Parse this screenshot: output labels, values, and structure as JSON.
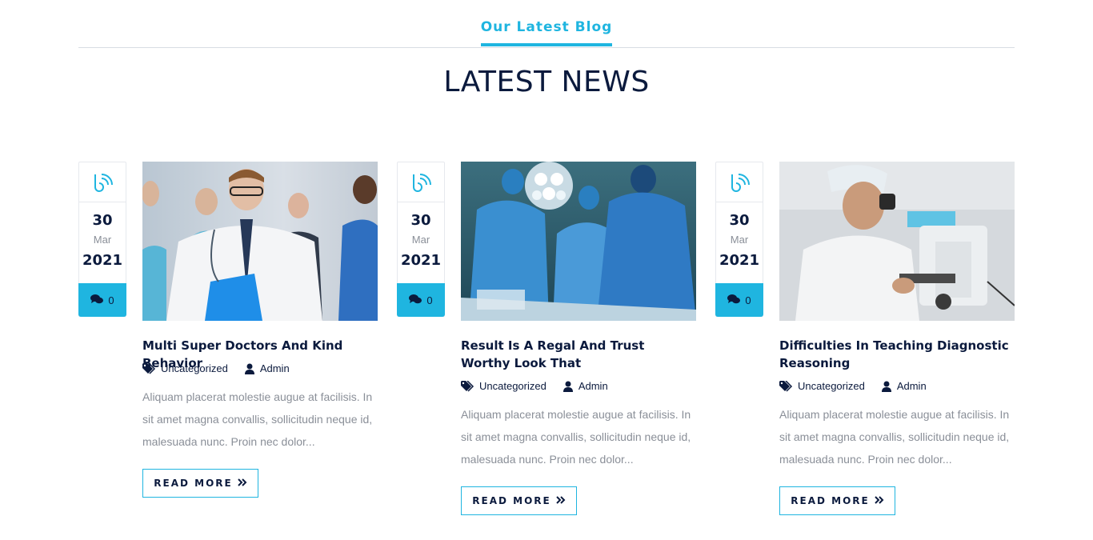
{
  "section": {
    "tag": "Our Latest Blog",
    "title": "LATEST NEWS"
  },
  "accent_color": "#1fb5e0",
  "heading_color": "#0b1a3d",
  "posts": [
    {
      "day": "30",
      "month": "Mar",
      "year": "2021",
      "comments": "0",
      "image": "doctors-team-photo",
      "title": "Multi Super Doctors And Kind Behavior",
      "category": "Uncategorized",
      "author": "Admin",
      "excerpt": "Aliquam placerat molestie augue at facilisis. In sit amet magna convallis, sollicitudin neque id, malesuada nunc. Proin nec dolor...",
      "read_more": "READ MORE"
    },
    {
      "day": "30",
      "month": "Mar",
      "year": "2021",
      "comments": "0",
      "image": "surgery-room-photo",
      "title": "Result Is A Regal And Trust Worthy Look That",
      "category": "Uncategorized",
      "author": "Admin",
      "excerpt": "Aliquam placerat molestie augue at facilisis. In sit amet magna convallis, sollicitudin neque id, malesuada nunc. Proin nec dolor...",
      "read_more": "READ MORE"
    },
    {
      "day": "30",
      "month": "Mar",
      "year": "2021",
      "comments": "0",
      "image": "microscope-lab-photo",
      "title": "Difficulties In Teaching Diagnostic Reasoning",
      "category": "Uncategorized",
      "author": "Admin",
      "excerpt": "Aliquam placerat molestie augue at facilisis. In sit amet magna convallis, sollicitudin neque id, malesuada nunc. Proin nec dolor...",
      "read_more": "READ MORE"
    }
  ]
}
